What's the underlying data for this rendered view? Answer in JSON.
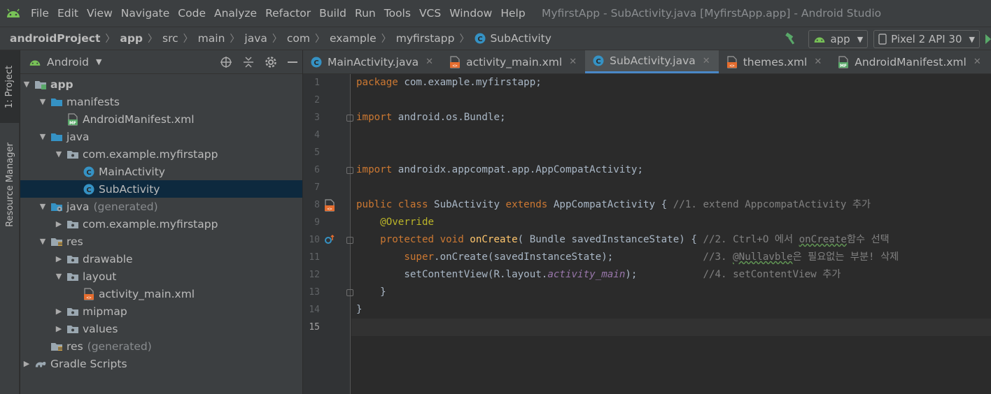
{
  "menu": {
    "items": [
      "File",
      "Edit",
      "View",
      "Navigate",
      "Code",
      "Analyze",
      "Refactor",
      "Build",
      "Run",
      "Tools",
      "VCS",
      "Window",
      "Help"
    ],
    "window_title": "MyfirstApp - SubActivity.java [MyfirstApp.app] - Android Studio"
  },
  "breadcrumb": [
    "androidProject",
    "app",
    "src",
    "main",
    "java",
    "com",
    "example",
    "myfirstapp",
    "SubActivity"
  ],
  "toolbar": {
    "run_config": "app",
    "device": "Pixel 2 API 30"
  },
  "side_tabs": {
    "project": "1: Project",
    "resource_manager": "Resource Manager"
  },
  "project_panel": {
    "view_mode": "Android",
    "tree": [
      {
        "label": "app",
        "extra": "",
        "depth": 0,
        "arrow": "down",
        "icon": "app-module-icon",
        "bold": true
      },
      {
        "label": "manifests",
        "extra": "",
        "depth": 1,
        "arrow": "down",
        "icon": "folder-icon"
      },
      {
        "label": "AndroidManifest.xml",
        "extra": "",
        "depth": 2,
        "arrow": "",
        "icon": "manifest-file-icon"
      },
      {
        "label": "java",
        "extra": "",
        "depth": 1,
        "arrow": "down",
        "icon": "folder-icon"
      },
      {
        "label": "com.example.myfirstapp",
        "extra": "",
        "depth": 2,
        "arrow": "down",
        "icon": "package-icon"
      },
      {
        "label": "MainActivity",
        "extra": "",
        "depth": 3,
        "arrow": "",
        "icon": "class-icon"
      },
      {
        "label": "SubActivity",
        "extra": "",
        "depth": 3,
        "arrow": "",
        "icon": "class-icon",
        "selected": true
      },
      {
        "label": "java",
        "extra": "(generated)",
        "depth": 1,
        "arrow": "down",
        "icon": "generated-folder-icon"
      },
      {
        "label": "com.example.myfirstapp",
        "extra": "",
        "depth": 2,
        "arrow": "right",
        "icon": "package-icon"
      },
      {
        "label": "res",
        "extra": "",
        "depth": 1,
        "arrow": "down",
        "icon": "res-folder-icon"
      },
      {
        "label": "drawable",
        "extra": "",
        "depth": 2,
        "arrow": "right",
        "icon": "package-icon"
      },
      {
        "label": "layout",
        "extra": "",
        "depth": 2,
        "arrow": "down",
        "icon": "package-icon"
      },
      {
        "label": "activity_main.xml",
        "extra": "",
        "depth": 3,
        "arrow": "",
        "icon": "xml-file-icon"
      },
      {
        "label": "mipmap",
        "extra": "",
        "depth": 2,
        "arrow": "right",
        "icon": "package-icon"
      },
      {
        "label": "values",
        "extra": "",
        "depth": 2,
        "arrow": "right",
        "icon": "package-icon"
      },
      {
        "label": "res",
        "extra": "(generated)",
        "depth": 1,
        "arrow": "",
        "icon": "res-folder-icon"
      },
      {
        "label": "Gradle Scripts",
        "extra": "",
        "depth": 0,
        "arrow": "right",
        "icon": "gradle-icon"
      }
    ]
  },
  "editor_tabs": [
    {
      "label": "MainActivity.java",
      "icon": "class-icon",
      "active": false
    },
    {
      "label": "activity_main.xml",
      "icon": "xml-file-icon",
      "active": false
    },
    {
      "label": "SubActivity.java",
      "icon": "class-icon",
      "active": true
    },
    {
      "label": "themes.xml",
      "icon": "xml-file-icon",
      "active": false
    },
    {
      "label": "AndroidManifest.xml",
      "icon": "manifest-file-icon",
      "active": false
    }
  ],
  "code": {
    "current_line": 15,
    "lines": [
      [
        [
          "kw",
          "package "
        ],
        [
          "",
          "com.example.myfirstapp;"
        ]
      ],
      [],
      [
        [
          "kw",
          "import "
        ],
        [
          "",
          "android.os.Bundle;"
        ]
      ],
      [],
      [],
      [
        [
          "kw",
          "import "
        ],
        [
          "",
          "androidx.appcompat.app.AppCompatActivity;"
        ]
      ],
      [],
      [
        [
          "kw",
          "public class "
        ],
        [
          "",
          "SubActivity "
        ],
        [
          "kw",
          "extends "
        ],
        [
          "",
          "AppCompatActivity { "
        ],
        [
          "cm",
          "//1. extend AppcompatActivity 추가"
        ]
      ],
      [
        [
          "ann",
          "    @Override"
        ]
      ],
      [
        [
          "kw",
          "    protected void "
        ],
        [
          "fn",
          "onCreate"
        ],
        [
          "",
          "( Bundle savedInstanceState) { "
        ],
        [
          "cm",
          "//2. Ctrl+O 에서 "
        ],
        [
          "cmsq",
          "onCreate"
        ],
        [
          "cm",
          "함수 선택"
        ]
      ],
      [
        [
          "kw",
          "        super"
        ],
        [
          "",
          ".onCreate(savedInstanceState);               "
        ],
        [
          "cm",
          "//3. "
        ],
        [
          "cmsq",
          "@Nullavble"
        ],
        [
          "cm",
          "은 필요없는 부분! 삭제"
        ]
      ],
      [
        [
          "",
          "        setContentView(R.layout."
        ],
        [
          "it",
          "activity_main"
        ],
        [
          "",
          ");           "
        ],
        [
          "cm",
          "//4. setContentView 추가"
        ]
      ],
      [
        [
          "",
          "    }"
        ]
      ],
      [
        [
          "",
          "}"
        ]
      ],
      []
    ]
  },
  "colors": {
    "accent": "#4a88c7",
    "android_green": "#78c257",
    "class_icon": "#3592c4",
    "xml_icon": "#e56d2f"
  }
}
